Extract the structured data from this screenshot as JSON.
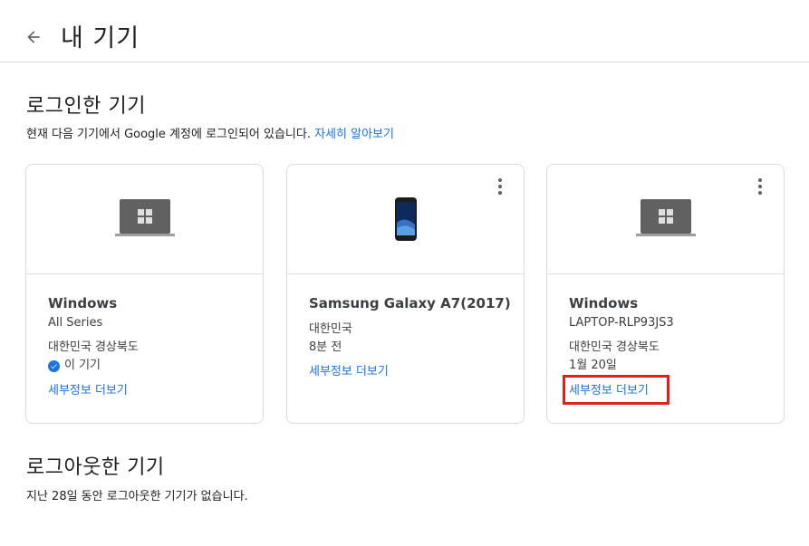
{
  "header": {
    "title": "내 기기",
    "back_icon": "arrow-back-icon"
  },
  "signed_in": {
    "title": "로그인한 기기",
    "description": "현재 다음 기기에서 Google 계정에 로그인되어 있습니다.",
    "learn_more": "자세히 알아보기"
  },
  "devices": [
    {
      "name": "Windows",
      "model": "All Series",
      "location": "대한민국 경상북도",
      "this_device": "이 기기",
      "details": "세부정보 더보기",
      "icon": "laptop-icon"
    },
    {
      "name": "Samsung Galaxy A7(2017)",
      "location": "대한민국",
      "time": "8분 전",
      "details": "세부정보 더보기",
      "icon": "phone-icon"
    },
    {
      "name": "Windows",
      "model": "LAPTOP-RLP93JS3",
      "location": "대한민국 경상북도",
      "time": "1월 20일",
      "details": "세부정보 더보기",
      "icon": "laptop-icon"
    }
  ],
  "signed_out": {
    "title": "로그아웃한 기기",
    "description": "지난 28일 동안 로그아웃한 기기가 없습니다."
  },
  "colors": {
    "link": "#1a73e8",
    "highlight": "#e0201b",
    "border": "#dadce0"
  }
}
